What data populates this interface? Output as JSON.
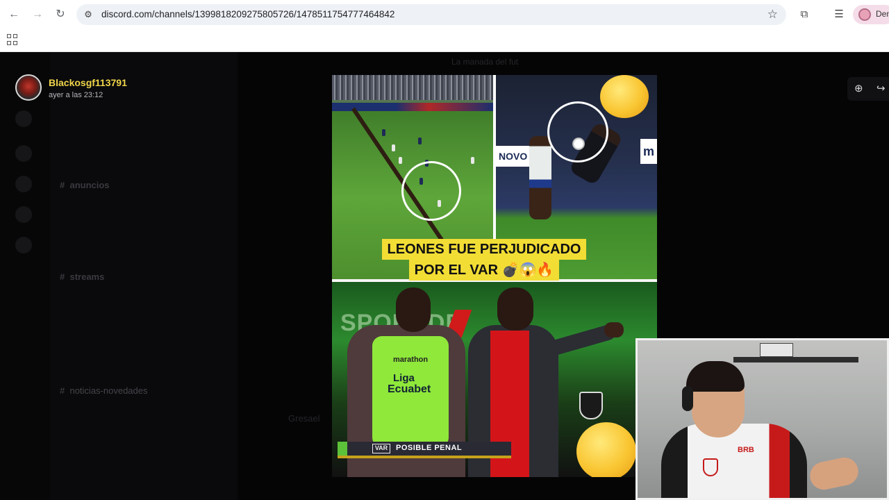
{
  "browser": {
    "url": "discord.com/channels/1399818209275805726/1478511754777464842",
    "profile_label": "Den",
    "icons": [
      "back-arrow-icon",
      "forward-arrow-icon",
      "reload-icon",
      "site-settings-icon",
      "star-icon",
      "extensions-icon",
      "reading-list-icon",
      "apps-grid-icon"
    ]
  },
  "discord": {
    "server_name": "La manada del fut",
    "channels": [
      {
        "label": "anuncios",
        "bold": true
      },
      {
        "label": "streams",
        "bold": true
      },
      {
        "label": "noticias-novedades",
        "bold": false,
        "selected": true
      }
    ],
    "author": {
      "name": "Blackosgf113791",
      "timestamp": "ayer a las 23:12"
    },
    "chat_user": "Gresael"
  },
  "media": {
    "headline_line1": "LEONES FUE PERJUDICADO",
    "headline_line2": "POR EL VAR 💣😱🔥",
    "board_left": "NOVO",
    "board_right": "m",
    "vest_brand": "marathon",
    "vest_line1": "Liga",
    "vest_line2": "Ecuabet",
    "sponsor_text": "SPORADE",
    "var_badge": "VAR",
    "lower_third": "POSIBLE PENAL"
  },
  "webcam": {
    "jersey_brand": "BRB"
  },
  "colors": {
    "author_name": "#f0d54a",
    "headline_bg": "#f2dd35",
    "vest": "#8fe83a"
  }
}
